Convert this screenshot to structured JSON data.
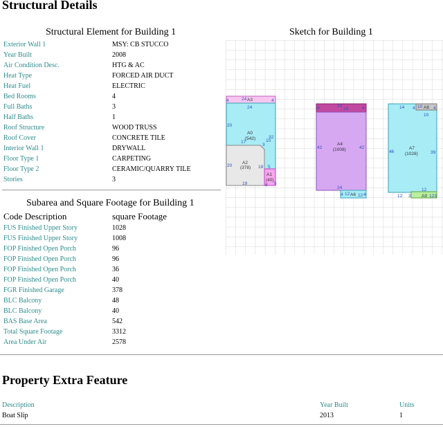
{
  "structural_title": "Structural Details",
  "element_title": "Structural Element for Building 1",
  "sketch_title": "Sketch for Building 1",
  "elements": [
    {
      "label": "Exterior Wall 1",
      "value": "MSY: CB STUCCO"
    },
    {
      "label": "Year Built",
      "value": "2008"
    },
    {
      "label": "Air Condition Desc.",
      "value": "HTG & AC"
    },
    {
      "label": "Heat Type",
      "value": "FORCED AIR DUCT"
    },
    {
      "label": "Heat Fuel",
      "value": "ELECTRIC"
    },
    {
      "label": "Bed Rooms",
      "value": "4"
    },
    {
      "label": "Full Baths",
      "value": "3"
    },
    {
      "label": "Half Baths",
      "value": "1"
    },
    {
      "label": "Roof Structure",
      "value": "WOOD TRUSS"
    },
    {
      "label": "Roof Cover",
      "value": "CONCRETE TILE"
    },
    {
      "label": "Interior Wall 1",
      "value": "DRYWALL"
    },
    {
      "label": "Floor Type 1",
      "value": "CARPETING"
    },
    {
      "label": "Floor Type 2",
      "value": "CERAMIC/QUARRY TILE"
    },
    {
      "label": "Stories",
      "value": "3"
    }
  ],
  "subarea_title": "Subarea and Square Footage for Building 1",
  "subarea_head": {
    "code": "Code Description",
    "sqft": "square Footage"
  },
  "subareas": [
    {
      "label": "FUS Finished Upper Story",
      "value": "1028"
    },
    {
      "label": "FUS Finished Upper Story",
      "value": "1008"
    },
    {
      "label": "FOP Finished Open Porch",
      "value": "96"
    },
    {
      "label": "FOP Finished Open Porch",
      "value": "96"
    },
    {
      "label": "FOP Finished Open Porch",
      "value": "36"
    },
    {
      "label": "FOP Finished Open Porch",
      "value": "40"
    },
    {
      "label": "FGR Finished Garage",
      "value": "378"
    },
    {
      "label": "BLC Balcony",
      "value": "48"
    },
    {
      "label": "BLC Balcony",
      "value": "40"
    },
    {
      "label": "BAS Base Area",
      "value": "542"
    },
    {
      "label": "Total Square Footage",
      "value": "3312"
    },
    {
      "label": "Area Under Air",
      "value": "2578"
    }
  ],
  "extra_title": "Property Extra Feature",
  "extra_head": {
    "description": "Description",
    "year": "Year Built",
    "units": "Units"
  },
  "extra_rows": [
    {
      "description": "Boat Slip",
      "year": "2013",
      "units": "1"
    }
  ],
  "sketch": {
    "labels": {
      "a0": "A0",
      "a0_area": "(542)",
      "a1": "A1",
      "a1_area": "(40)",
      "a2": "A2",
      "a2_area": "(378)",
      "a3": "A3",
      "a4": "A4",
      "a4_area": "(1008)",
      "a6": "A6",
      "a7": "A7",
      "a7_area": "(1028)",
      "a8": "A8",
      "a9": "A9"
    },
    "dims": {
      "d1": "4",
      "d2": "24",
      "d3": "4",
      "d4": "24",
      "d5": "20",
      "d6": "32",
      "d7": "17",
      "d8": "3",
      "d9": "10",
      "d10": "20",
      "d11": "18",
      "d12": "5",
      "d13": "19",
      "d14": "8",
      "d15": "5",
      "d16": "4",
      "d17": "24",
      "d18": "4",
      "d19": "24",
      "d20": "42",
      "d21": "42",
      "d22": "24",
      "d23": "4",
      "d24": "12",
      "d25": "12",
      "d26": "4",
      "d27": "14",
      "d28": "4",
      "d29": "10",
      "d30": "4",
      "d31": "10",
      "d32": "46",
      "d33": "39",
      "d34": "12",
      "d35": "12",
      "d36": "3",
      "d37": "123"
    }
  }
}
